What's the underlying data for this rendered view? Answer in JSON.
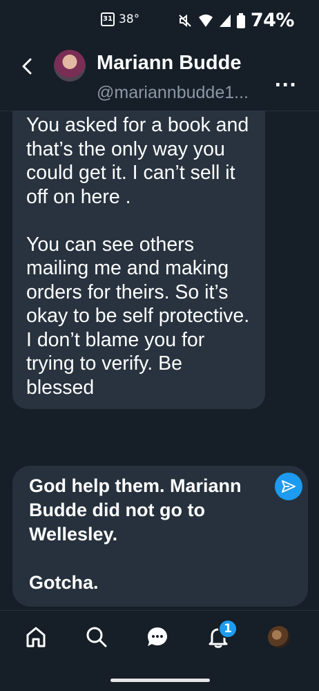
{
  "status_bar": {
    "calendar_day": "31",
    "temperature": "38°",
    "battery": "74%",
    "icons": [
      "calendar-icon",
      "mute-icon",
      "wifi-icon",
      "signal-icon",
      "battery-icon"
    ]
  },
  "header": {
    "name": "Mariann Budde",
    "handle": "@mariannbudde1...",
    "more": "..."
  },
  "messages": [
    {
      "direction": "incoming",
      "text": "You asked for a book and that’s the only way you could get it. I can’t sell it off on here .\n\nYou can see others mailing me and making orders for theirs. So it’s okay to be self protective. I don’t blame you for trying to verify. Be blessed"
    }
  ],
  "compose": {
    "text": "God help them. Mariann Budde did not go to Wellesley.\n\nGotcha."
  },
  "nav": {
    "items": [
      "home-icon",
      "search-icon",
      "messages-icon",
      "notifications-icon",
      "profile-avatar"
    ],
    "notification_count": "1"
  },
  "colors": {
    "background": "#161e27",
    "bubble": "#28333f",
    "accent": "#1d9bf0",
    "secondary_text": "#8b98a5"
  }
}
